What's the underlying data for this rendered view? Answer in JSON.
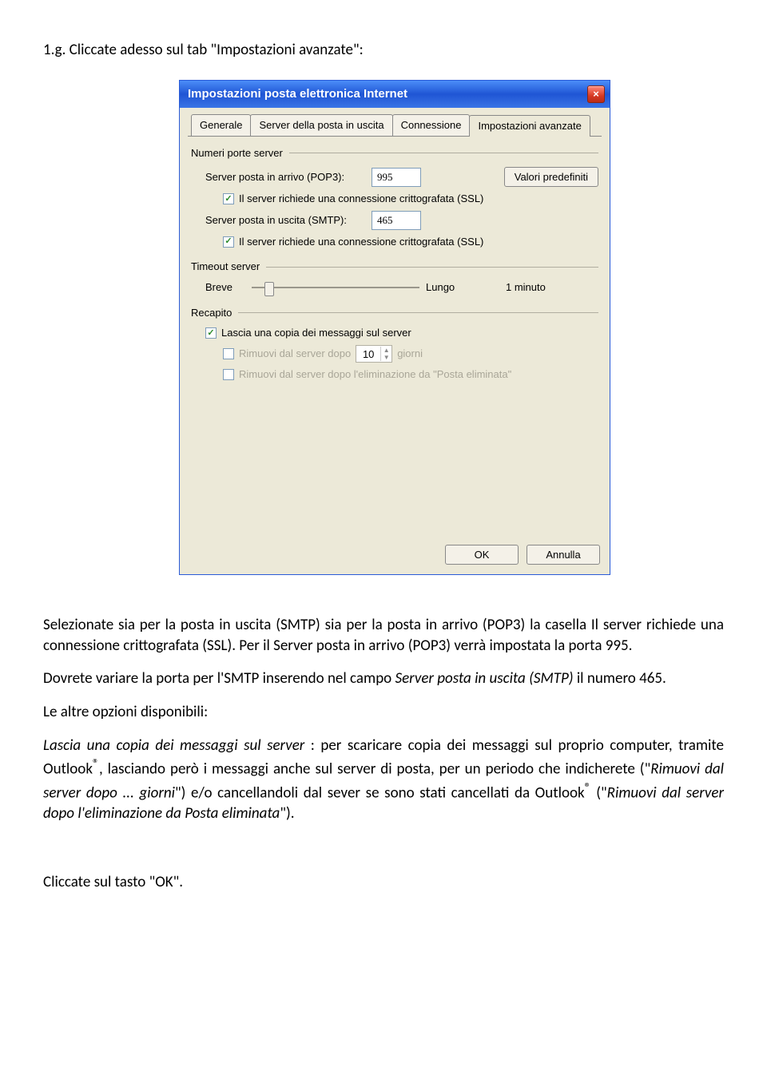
{
  "doc": {
    "heading": "1.g. Cliccate adesso sul tab \"Impostazioni avanzate\":",
    "p1": "Selezionate sia per la posta in uscita (SMTP) sia per la posta in arrivo (POP3) la casella Il server richiede una connessione crittografata (SSL). Per il Server posta in arrivo (POP3) verrà impostata la porta 995.",
    "p2_a": "Dovrete variare la porta per l'SMTP inserendo nel campo ",
    "p2_i": "Server posta in uscita (SMTP)",
    "p2_b": " il numero 465.",
    "p3": "Le altre opzioni disponibili:",
    "p4_i1": "Lascia una copia dei messaggi sul server",
    "p4_a": " : per scaricare copia dei messaggi sul proprio computer, tramite Outlook",
    "p4_sup1": "®",
    "p4_b": ", lasciando però i messaggi anche sul server di posta, per un periodo che indicherete (\"",
    "p4_i2": "Rimuovi dal server dopo ... giorni",
    "p4_c": "\") e/o cancellandoli dal sever se sono stati cancellati da Outlook",
    "p4_sup2": "®",
    "p4_d": " (\"",
    "p4_i3": "Rimuovi dal server dopo l'eliminazione da Posta eliminata",
    "p4_e": "\").",
    "p5": "Cliccate sul tasto \"OK\"."
  },
  "dialog": {
    "title": "Impostazioni posta elettronica Internet",
    "close_icon": "×",
    "tabs": {
      "generale": "Generale",
      "uscita": "Server della posta in uscita",
      "connessione": "Connessione",
      "avanzate": "Impostazioni avanzate"
    },
    "groups": {
      "ports": "Numeri porte server",
      "timeout": "Timeout server",
      "delivery": "Recapito"
    },
    "ports": {
      "pop3_label": "Server posta in arrivo (POP3):",
      "pop3_value": "995",
      "defaults_btn": "Valori predefiniti",
      "ssl1": "Il server richiede una connessione crittografata (SSL)",
      "smtp_label": "Server posta in uscita (SMTP):",
      "smtp_value": "465",
      "ssl2": "Il server richiede una connessione crittografata (SSL)"
    },
    "timeout": {
      "short": "Breve",
      "long": "Lungo",
      "value": "1 minuto"
    },
    "delivery": {
      "leave_copy": "Lascia una copia dei messaggi sul server",
      "remove_after_a": "Rimuovi dal server dopo",
      "remove_after_days": "10",
      "remove_after_b": "giorni",
      "remove_deleted": "Rimuovi dal server dopo l'eliminazione da \"Posta eliminata\""
    },
    "buttons": {
      "ok": "OK",
      "cancel": "Annulla"
    },
    "check_glyph": "✓"
  }
}
